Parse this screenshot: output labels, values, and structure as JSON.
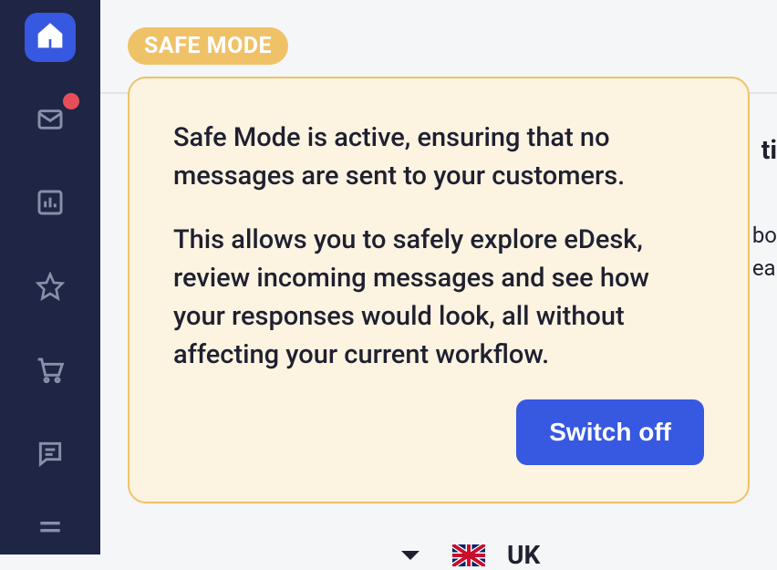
{
  "sidebar": {
    "items": [
      {
        "name": "home",
        "active": true
      },
      {
        "name": "mail",
        "active": false,
        "hasNotification": true
      },
      {
        "name": "analytics",
        "active": false
      },
      {
        "name": "favorites",
        "active": false
      },
      {
        "name": "cart",
        "active": false
      },
      {
        "name": "chat",
        "active": false
      },
      {
        "name": "menu",
        "active": false
      }
    ]
  },
  "badge": {
    "label": "SAFE MODE"
  },
  "infoCard": {
    "paragraph1": "Safe Mode is active, ensuring that no messages are sent to your customers.",
    "paragraph2": "This allows you to safely explore eDesk, review incoming messages and see how your responses would look, all without affecting your current workflow.",
    "buttonLabel": "Switch off"
  },
  "backgroundPartial": {
    "heading": "ti",
    "line1": "bo",
    "line2": "ea"
  },
  "flagRow": {
    "text": "UK"
  }
}
